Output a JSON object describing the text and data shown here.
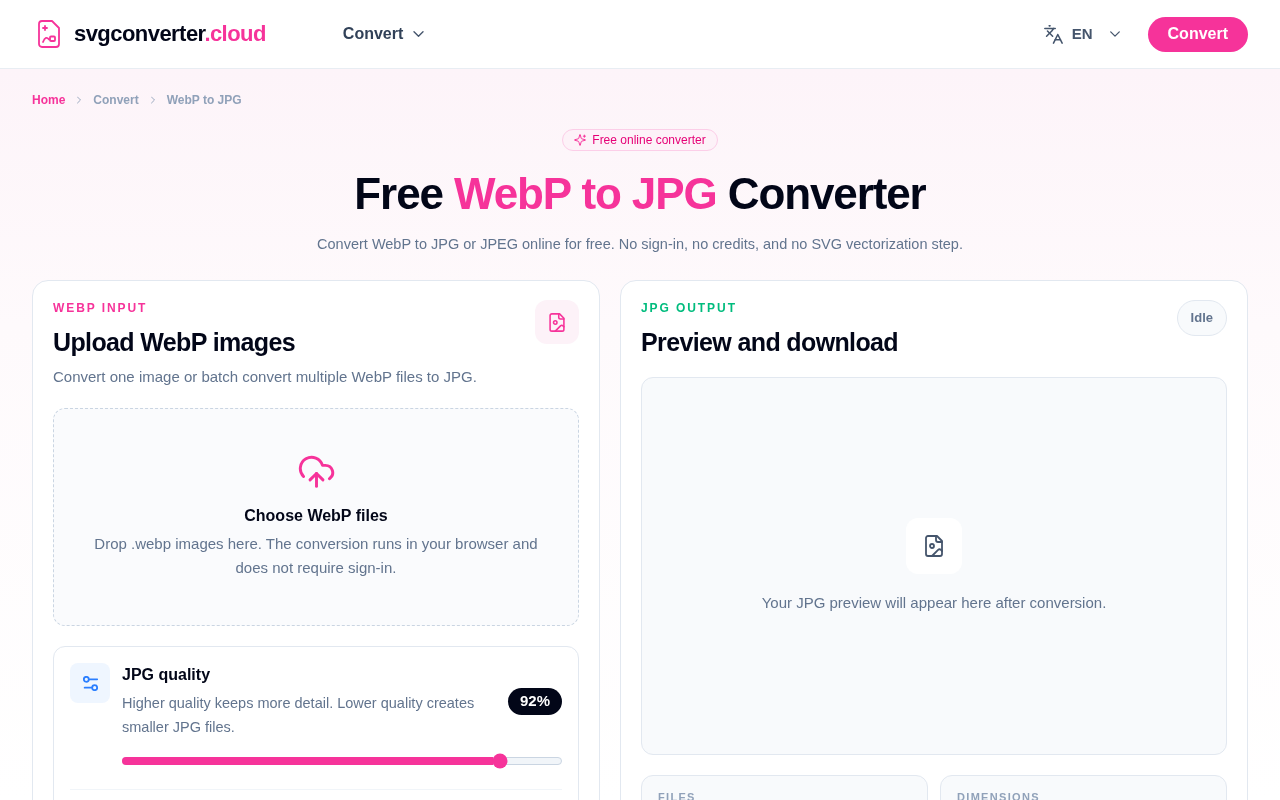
{
  "header": {
    "logo": {
      "name": "svgconverter",
      "suffix": ".cloud"
    },
    "nav": [
      {
        "label": "Convert",
        "has_menu": true
      }
    ],
    "language": {
      "code": "EN",
      "has_menu": true
    },
    "cta": "Convert"
  },
  "breadcrumb": [
    {
      "label": "Home",
      "kind": "link"
    },
    {
      "label": "Convert",
      "kind": "text"
    },
    {
      "label": "WebP to JPG",
      "kind": "text"
    }
  ],
  "hero": {
    "badge": "Free online converter",
    "title": [
      {
        "text": "Free ",
        "highlight": false
      },
      {
        "text": "WebP to JPG",
        "highlight": true
      },
      {
        "text": " Converter",
        "highlight": false
      }
    ],
    "subtitle": "Convert WebP to JPG or JPEG online for free. No sign-in, no credits, and no SVG vectorization step."
  },
  "input_panel": {
    "eyebrow": "WEBP INPUT",
    "title": "Upload WebP images",
    "description": "Convert one image or batch convert multiple WebP files to JPG.",
    "dropzone": {
      "title": "Choose WebP files",
      "text": "Drop .webp images here. The conversion runs in your browser and does not require sign-in."
    },
    "quality": {
      "title": "JPG quality",
      "description": "Higher quality keeps more detail. Lower quality creates smaller JPG files.",
      "value": "92%",
      "level": 0.86
    }
  },
  "output_panel": {
    "eyebrow": "JPG OUTPUT",
    "title": "Preview and download",
    "status": "Idle",
    "preview": {
      "text": "Your JPG preview will appear here after conversion."
    },
    "stats": [
      {
        "label": "FILES"
      },
      {
        "label": "DIMENSIONS"
      }
    ]
  }
}
